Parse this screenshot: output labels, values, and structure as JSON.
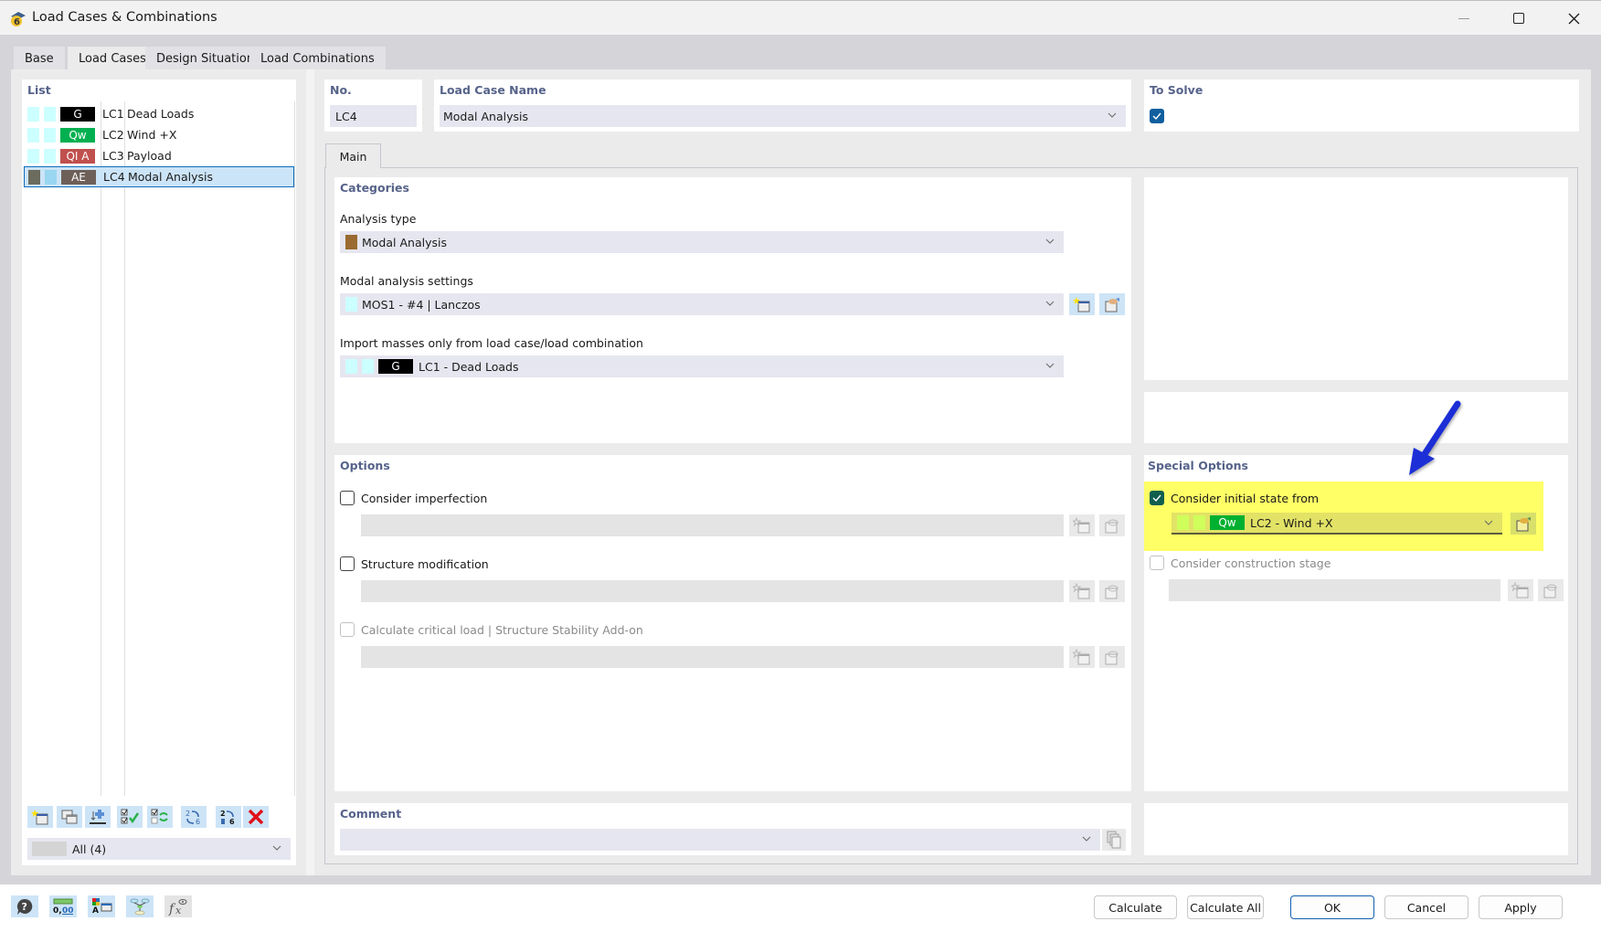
{
  "window": {
    "title": "Load Cases & Combinations",
    "controls": [
      "minimize",
      "maximize",
      "close"
    ]
  },
  "tabs": [
    {
      "label": "Base",
      "active": false
    },
    {
      "label": "Load Cases",
      "active": true
    },
    {
      "label": "Design Situations",
      "active": false
    },
    {
      "label": "Load Combinations",
      "active": false
    }
  ],
  "list": {
    "header": "List",
    "items": [
      {
        "chip": "G",
        "chip_color": "#000000",
        "sq1": "#ccffff",
        "sq2": "#ccffff",
        "id": "LC1",
        "name": "Dead Loads",
        "selected": false
      },
      {
        "chip": "Qw",
        "chip_color": "#00b050",
        "sq1": "#ccffff",
        "sq2": "#ccffff",
        "id": "LC2",
        "name": "Wind +X",
        "selected": false
      },
      {
        "chip": "QI A",
        "chip_color": "#c0504d",
        "sq1": "#ccffff",
        "sq2": "#ccffff",
        "id": "LC3",
        "name": "Payload",
        "selected": false
      },
      {
        "chip": "AE",
        "chip_color": "#6e6059",
        "sq1": "#6b6b5e",
        "sq2": "#99d6f0",
        "id": "LC4",
        "name": "Modal Analysis",
        "selected": true
      }
    ],
    "toolbar": [
      "new-icon",
      "copy-icon",
      "insert-icon",
      "check-all-icon",
      "toggle-check-icon",
      "renumber-icon",
      "renumber-selected-icon",
      "delete-icon"
    ],
    "filter": {
      "value": "All (4)"
    }
  },
  "header_fields": {
    "no_label": "No.",
    "no_value": "LC4",
    "name_label": "Load Case Name",
    "name_value": "Modal Analysis",
    "to_solve_label": "To Solve",
    "to_solve_checked": true
  },
  "inner_tabs": [
    {
      "label": "Main",
      "active": true
    }
  ],
  "categories": {
    "header": "Categories",
    "analysis_type_label": "Analysis type",
    "analysis_type_value": "Modal Analysis",
    "analysis_type_color": "#9a6a30",
    "modal_settings_label": "Modal analysis settings",
    "modal_settings_value": "MOS1 - #4 | Lanczos",
    "import_masses_label": "Import masses only from load case/load combination",
    "import_masses_chip": "G",
    "import_masses_value": "LC1 - Dead Loads"
  },
  "options": {
    "header": "Options",
    "items": [
      {
        "label": "Consider imperfection",
        "checked": false,
        "enabled": true
      },
      {
        "label": "Structure modification",
        "checked": false,
        "enabled": true
      },
      {
        "label": "Calculate critical load | Structure Stability Add-on",
        "checked": false,
        "enabled": false
      }
    ]
  },
  "special_options": {
    "header": "Special Options",
    "initial_state": {
      "label": "Consider initial state from",
      "checked": true,
      "chip": "Qw",
      "value": "LC2 - Wind +X"
    },
    "construction_stage": {
      "label": "Consider construction stage",
      "checked": false,
      "enabled": false
    },
    "highlight_color": "#ffff66",
    "arrow_color": "#1a2fd6"
  },
  "comment": {
    "label": "Comment",
    "value": ""
  },
  "bottom_icons": [
    "help-icon",
    "units-icon",
    "display-properties-icon",
    "hierarchy-icon",
    "formula-icon"
  ],
  "buttons": {
    "calculate": "Calculate",
    "calculate_all": "Calculate All",
    "ok": "OK",
    "cancel": "Cancel",
    "apply": "Apply"
  }
}
